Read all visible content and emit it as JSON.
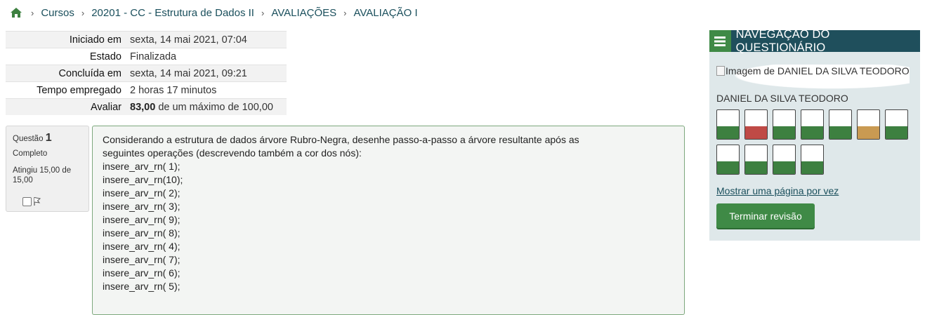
{
  "breadcrumb": {
    "items": [
      "Cursos",
      "20201 - CC - Estrutura de Dados II",
      "AVALIAÇÕES",
      "AVALIAÇÃO I"
    ]
  },
  "summary": {
    "rows": [
      {
        "label": "Iniciado em",
        "value": "sexta, 14 mai 2021, 07:04"
      },
      {
        "label": "Estado",
        "value": "Finalizada"
      },
      {
        "label": "Concluída em",
        "value": "sexta, 14 mai 2021, 09:21"
      },
      {
        "label": "Tempo empregado",
        "value": "2 horas 17 minutos"
      }
    ],
    "grade_label": "Avaliar",
    "grade_value": "83,00",
    "grade_suffix": "de um máximo de 100,00"
  },
  "question": {
    "prefix": "Questão",
    "number": "1",
    "state": "Completo",
    "grade": "Atingiu 15,00 de 15,00",
    "text_intro_1": "Considerando a estrutura de dados árvore Rubro-Negra, desenhe passo-a-passo a árvore resultante após as",
    "text_intro_2": "seguintes operações (descrevendo também a cor dos nós):",
    "operations": [
      "insere_arv_rn( 1);",
      "insere_arv_rn(10);",
      "insere_arv_rn( 2);",
      "insere_arv_rn( 3);",
      "insere_arv_rn( 9);",
      "insere_arv_rn( 8);",
      "insere_arv_rn( 4);",
      "insere_arv_rn( 7);",
      "insere_arv_rn( 6);",
      "insere_arv_rn( 5);"
    ]
  },
  "nav": {
    "title": "NAVEGAÇÃO DO QUESTIONÁRIO",
    "avatar_alt": "Imagem de DANIEL DA SILVA TEODORO",
    "username": "DANIEL DA SILVA TEODORO",
    "question_states": [
      "correct",
      "incorrect",
      "correct",
      "correct",
      "correct",
      "partial",
      "correct",
      "correct",
      "correct",
      "correct",
      "correct"
    ],
    "show_one_page": "Mostrar uma página por vez",
    "finish_review": "Terminar revisão"
  },
  "colors": {
    "header_bg": "#1f4f5c",
    "accent_green": "#3f8a46",
    "correct": "#3d8040",
    "incorrect": "#bf4a46",
    "partial": "#c99a52"
  },
  "icons": [
    "home-icon",
    "chevron-right-icon",
    "hamburger-menu-icon",
    "flag-icon",
    "broken-image-icon"
  ]
}
